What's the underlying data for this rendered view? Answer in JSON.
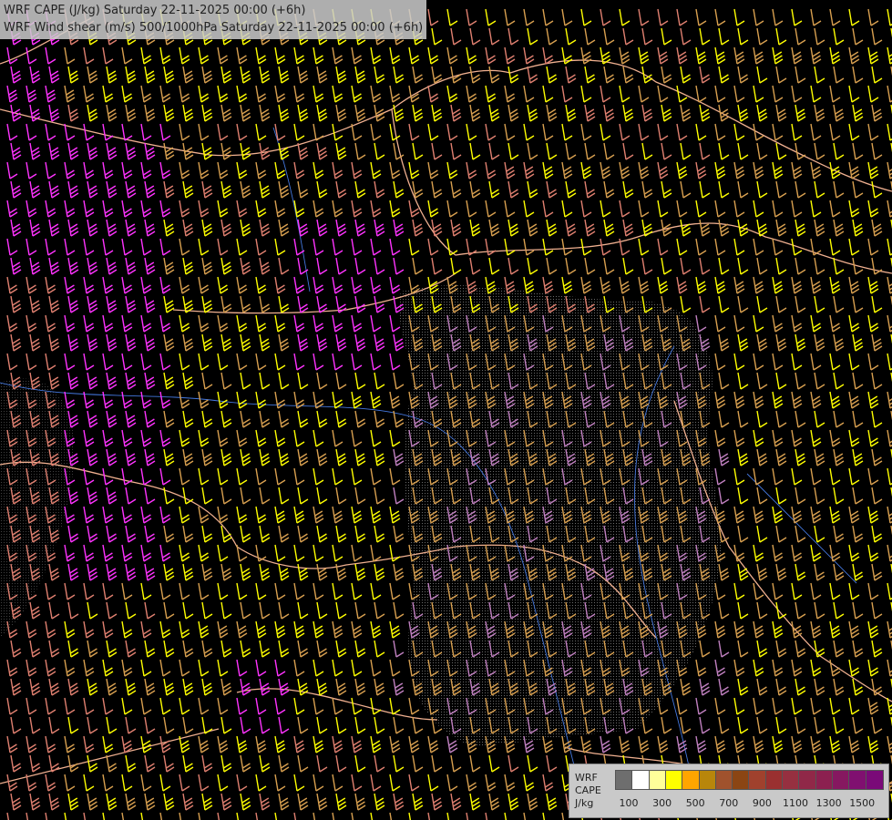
{
  "title": {
    "line1": "WRF CAPE (J/kg) Saturday 22-11-2025 00:00 (+6h)",
    "line2": "WRF Wind shear (m/s) 500/1000hPa Saturday 22-11-2025 00:00 (+6h)"
  },
  "legend": {
    "label1": "WRF",
    "label2": "CAPE",
    "label3": "J/kg",
    "colors": [
      "#6e6e6e",
      "#ffffff",
      "#ffff9a",
      "#ffff00",
      "#ffa500",
      "#b8860b",
      "#a0522d",
      "#8b4513",
      "#a0412d",
      "#9a3030",
      "#963040",
      "#902848",
      "#8c2050",
      "#861860",
      "#801070",
      "#7a0a78"
    ],
    "ticks": [
      "100",
      "300",
      "500",
      "700",
      "900",
      "1100",
      "1300",
      "1500"
    ]
  },
  "map": {
    "barb_colors": [
      "#ffff00",
      "#d8a050",
      "#e08070",
      "#ff33ff",
      "#c080c0",
      "#f0d070"
    ],
    "border_color": "#f0b090",
    "river_color": "#4477dd"
  }
}
